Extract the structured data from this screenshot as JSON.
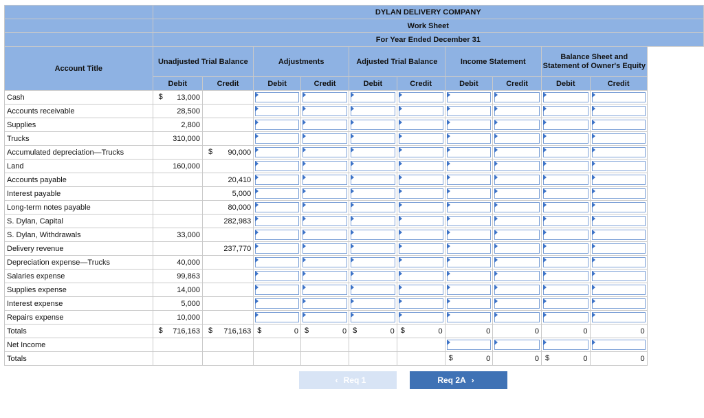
{
  "header": {
    "company": "DYLAN DELIVERY COMPANY",
    "sheet": "Work Sheet",
    "period": "For Year Ended December 31"
  },
  "column_groups": {
    "account_title": "Account Title",
    "unadjusted": "Unadjusted Trial Balance",
    "adjustments": "Adjustments",
    "adjusted": "Adjusted Trial Balance",
    "income": "Income Statement",
    "balance": "Balance Sheet and Statement of Owner's Equity"
  },
  "sub_headers": {
    "debit": "Debit",
    "credit": "Credit"
  },
  "accounts": [
    {
      "name": "Cash",
      "debit": "13,000",
      "credit": "",
      "debit_dollar": "$",
      "credit_dollar": ""
    },
    {
      "name": "Accounts receivable",
      "debit": "28,500",
      "credit": "",
      "debit_dollar": "",
      "credit_dollar": ""
    },
    {
      "name": "Supplies",
      "debit": "2,800",
      "credit": "",
      "debit_dollar": "",
      "credit_dollar": ""
    },
    {
      "name": "Trucks",
      "debit": "310,000",
      "credit": "",
      "debit_dollar": "",
      "credit_dollar": ""
    },
    {
      "name": "Accumulated depreciation—Trucks",
      "debit": "",
      "credit": "90,000",
      "debit_dollar": "",
      "credit_dollar": "$"
    },
    {
      "name": "Land",
      "debit": "160,000",
      "credit": "",
      "debit_dollar": "",
      "credit_dollar": ""
    },
    {
      "name": "Accounts payable",
      "debit": "",
      "credit": "20,410",
      "debit_dollar": "",
      "credit_dollar": ""
    },
    {
      "name": "Interest payable",
      "debit": "",
      "credit": "5,000",
      "debit_dollar": "",
      "credit_dollar": ""
    },
    {
      "name": "Long-term notes payable",
      "debit": "",
      "credit": "80,000",
      "debit_dollar": "",
      "credit_dollar": ""
    },
    {
      "name": "S. Dylan, Capital",
      "debit": "",
      "credit": "282,983",
      "debit_dollar": "",
      "credit_dollar": ""
    },
    {
      "name": "S. Dylan, Withdrawals",
      "debit": "33,000",
      "credit": "",
      "debit_dollar": "",
      "credit_dollar": ""
    },
    {
      "name": "Delivery revenue",
      "debit": "",
      "credit": "237,770",
      "debit_dollar": "",
      "credit_dollar": ""
    },
    {
      "name": "Depreciation expense—Trucks",
      "debit": "40,000",
      "credit": "",
      "debit_dollar": "",
      "credit_dollar": ""
    },
    {
      "name": "Salaries expense",
      "debit": "99,863",
      "credit": "",
      "debit_dollar": "",
      "credit_dollar": ""
    },
    {
      "name": "Supplies expense",
      "debit": "14,000",
      "credit": "",
      "debit_dollar": "",
      "credit_dollar": ""
    },
    {
      "name": "Interest expense",
      "debit": "5,000",
      "credit": "",
      "debit_dollar": "",
      "credit_dollar": ""
    },
    {
      "name": "Repairs expense",
      "debit": "10,000",
      "credit": "",
      "debit_dollar": "",
      "credit_dollar": ""
    }
  ],
  "totals_row": {
    "label": "Totals",
    "dollar": "$",
    "unadj_debit": "716,163",
    "unadj_credit": "716,163",
    "zero": "0"
  },
  "net_income_row": {
    "label": "Net Income"
  },
  "final_totals_row": {
    "label": "Totals",
    "dollar": "$",
    "zero": "0"
  },
  "navigation": {
    "prev_label": "Req 1",
    "next_label": "Req 2A",
    "prev_chevron": "‹",
    "next_chevron": "›"
  }
}
